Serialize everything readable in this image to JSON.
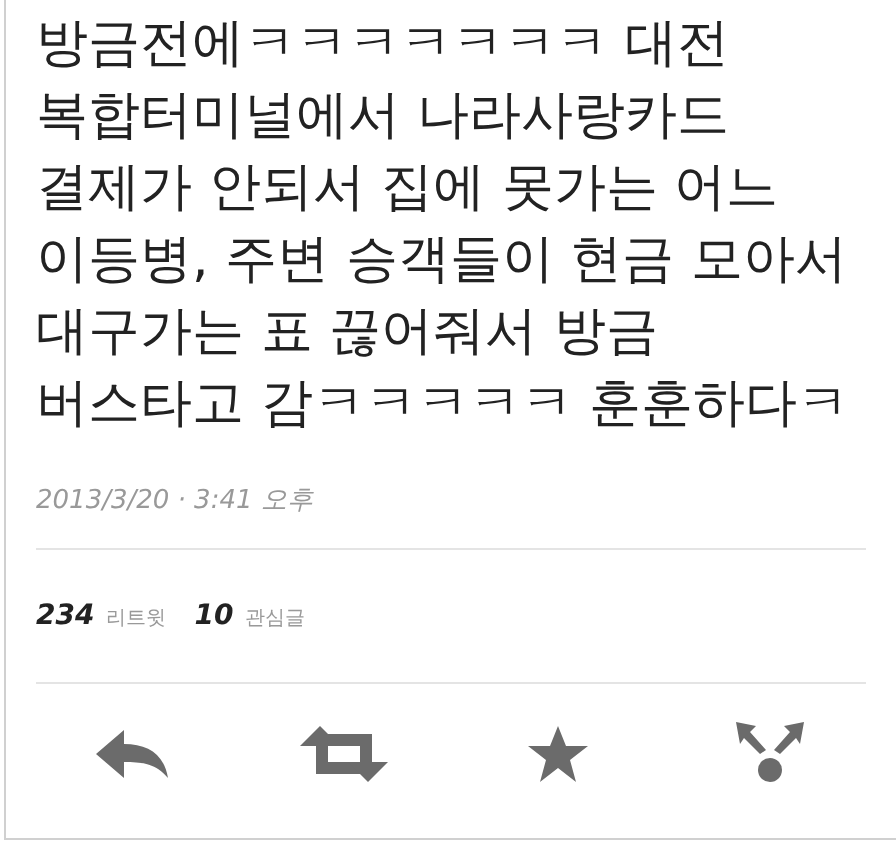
{
  "tweet": {
    "text": "방금전에ㅋㅋㅋㅋㅋㅋㅋ 대전\n복합터미널에서 나라사랑카드\n결제가 안되서 집에 못가는 어느\n이등병, 주변 승객들이 현금 모아서\n대구가는 표 끊어줘서 방금\n버스타고 감ㅋㅋㅋㅋㅋ 훈훈하다ㅋ",
    "timestamp": "2013/3/20 · 3:41 오후"
  },
  "stats": [
    {
      "count": "234",
      "label": "리트윗"
    },
    {
      "count": "10",
      "label": "관심글"
    }
  ],
  "actions": [
    {
      "kind": "reply"
    },
    {
      "kind": "retweet"
    },
    {
      "kind": "favorite"
    },
    {
      "kind": "share"
    }
  ]
}
